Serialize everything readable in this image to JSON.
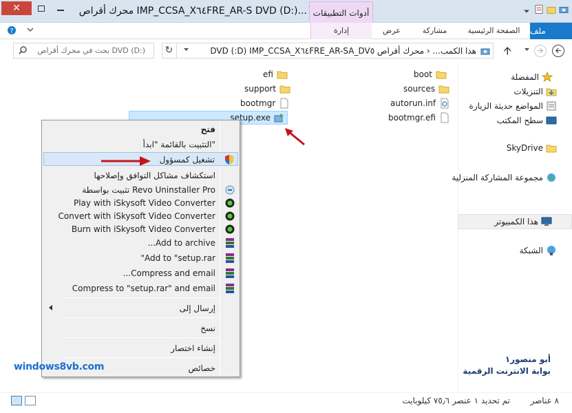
{
  "window": {
    "title": "محرك أقراص IMP_CCSA_X٦٤FRE_AR-S DVD (D:)...",
    "context_tab": "أدوات التطبيقات",
    "close_glyph": "✕"
  },
  "ribbon": {
    "file": "ملف",
    "home": "الصفحة الرئيسية",
    "share": "مشاركة",
    "view": "عرض",
    "manage": "إدارة"
  },
  "address": {
    "path": "‏هذا الكمب... ‹ محرك أقراص IMP_CCSA_X٦٤FRE_AR-SA_DV٥ (D:) DVD",
    "search_placeholder": "بحث في محرك أقراص DVD (D:)",
    "refresh_glyph": "↻",
    "up_glyph": "🡩",
    "back_glyph": "🡨",
    "forward_glyph": "🡪"
  },
  "navpane": {
    "favorites": "المفضلة",
    "downloads": "التنزيلات",
    "recent": "المواضع حديثة الزيارة",
    "desktop": "سطح المكتب",
    "skydrive": "SkyDrive",
    "homegroup": "مجموعة المشاركة المنزلية",
    "computer": "هذا الكمبيوتر",
    "network": "الشبكة"
  },
  "files": [
    {
      "name": "boot",
      "type": "folder"
    },
    {
      "name": "efi",
      "type": "folder"
    },
    {
      "name": "sources",
      "type": "folder"
    },
    {
      "name": "support",
      "type": "folder"
    },
    {
      "name": "autorun.inf",
      "type": "inf"
    },
    {
      "name": "bootmgr",
      "type": "file"
    },
    {
      "name": "bootmgr.efi",
      "type": "file"
    },
    {
      "name": "setup.exe",
      "type": "exe"
    }
  ],
  "context_menu": {
    "open": "فتح",
    "pin_start": "التثبيت بالقائمة \"ابدأ\"",
    "run_as_admin": "تشغيل كمسؤول",
    "troubleshoot": "استكشاف مشاكل التوافق وإصلاحها",
    "revo": "تثبيت بواسطة Revo Uninstaller Pro",
    "play_isky": "Play with iSkysoft Video Converter",
    "convert_isky": "Convert with iSkysoft Video Converter",
    "burn_isky": "Burn with iSkysoft Video Converter",
    "add_archive": "...Add to archive",
    "add_rar": "\"Add to \"setup.rar",
    "compress_email": "...Compress and email",
    "compress_rar_email": "Compress to \"setup.rar\" and email",
    "send_to": "إرسال إلى",
    "copy": "نسخ",
    "create_shortcut": "إنشاء اختصار",
    "properties": "خصائص"
  },
  "status": {
    "items": "٨ عناصر",
    "selected": "تم تحديد ١ عنصر ٧٥٫٦ كيلوبايت"
  },
  "watermark": {
    "left": "windows8vb.com",
    "right_line1": "أبو منصور١",
    "right_line2": "بوابة الانترنت الرقمية"
  },
  "colors": {
    "accent": "#1979ca",
    "context_tab": "#efd8f3",
    "selection": "#cce8ff",
    "arrow": "#c4161c"
  }
}
